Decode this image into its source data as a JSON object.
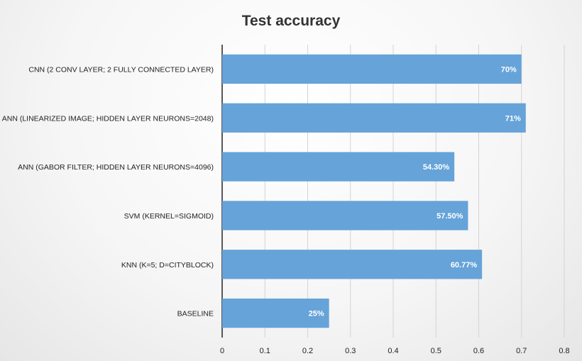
{
  "chart_data": {
    "type": "bar",
    "orientation": "horizontal",
    "title": "Test accuracy",
    "xlabel": "",
    "ylabel": "",
    "categories": [
      "CNN (2 CONV LAYER; 2 FULLY CONNECTED LAYER)",
      "ANN (LINEARIZED IMAGE; HIDDEN LAYER NEURONS=2048)",
      "ANN (GABOR FILTER; HIDDEN LAYER NEURONS=4096)",
      "SVM (KERNEL=SIGMOID)",
      "KNN (K=5; D=CITYBLOCK)",
      "BASELINE"
    ],
    "values": [
      0.7,
      0.71,
      0.543,
      0.575,
      0.6077,
      0.25
    ],
    "data_labels": [
      "70%",
      "71%",
      "54.30%",
      "57.50%",
      "60.77%",
      "25%"
    ],
    "xlim": [
      0,
      0.8
    ],
    "ticks": [
      0,
      0.1,
      0.2,
      0.3,
      0.4,
      0.5,
      0.6,
      0.7,
      0.8
    ],
    "tick_labels": [
      "0",
      "0.1",
      "0.2",
      "0.3",
      "0.4",
      "0.5",
      "0.6",
      "0.7",
      "0.8"
    ],
    "grid": true,
    "legend": "none",
    "bar_color": "#66a3d9",
    "grid_color": "#d4d4d4"
  }
}
